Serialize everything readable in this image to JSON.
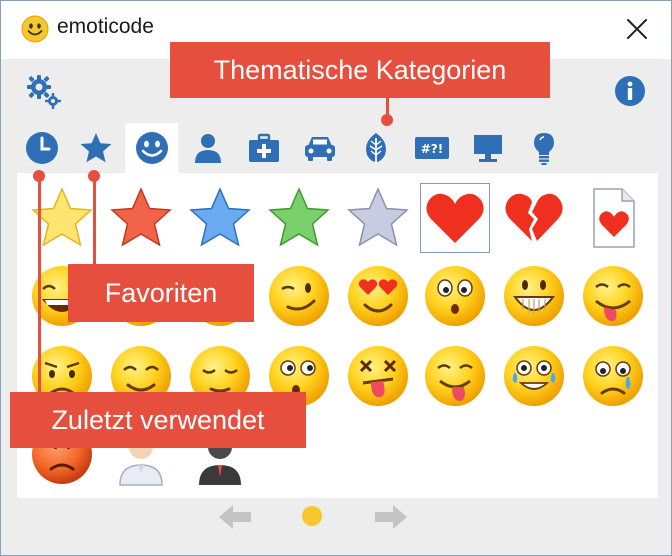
{
  "window": {
    "title": "emoticode"
  },
  "icons": {
    "app": "smiley-icon",
    "close": "close-icon",
    "settings": "gear-icon",
    "info": "info-icon",
    "prev": "arrow-left-icon",
    "next": "arrow-right-icon"
  },
  "tabs": [
    {
      "icon": "clock-icon",
      "active": false
    },
    {
      "icon": "star-icon",
      "active": false
    },
    {
      "icon": "smiley-icon",
      "active": true
    },
    {
      "icon": "person-icon",
      "active": false
    },
    {
      "icon": "medical-kit-icon",
      "active": false
    },
    {
      "icon": "car-icon",
      "active": false
    },
    {
      "icon": "leaf-icon",
      "active": false
    },
    {
      "icon": "symbols-icon",
      "active": false,
      "label": "#?!"
    },
    {
      "icon": "monitor-icon",
      "active": false
    },
    {
      "icon": "lightbulb-icon",
      "active": false
    }
  ],
  "grid": {
    "rows": [
      [
        "star-yellow-icon",
        "star-red-icon",
        "star-blue-icon",
        "star-green-icon",
        "star-silver-icon",
        "heart-icon",
        "broken-heart-icon",
        "heart-document-icon"
      ],
      [
        "laughing-face-icon",
        "smiling-face-icon",
        "grinning-face-icon",
        "winking-face-icon",
        "heart-eyes-face-icon",
        "surprised-face-icon",
        "toothy-grin-face-icon",
        "tongue-wink-face-icon"
      ],
      [
        "worried-face-icon",
        "content-face-icon",
        "relieved-face-icon",
        "confused-face-icon",
        "dizzy-face-icon",
        "tongue-out-face-icon",
        "tears-of-joy-face-icon",
        "crying-face-icon"
      ],
      [
        "angry-face-icon",
        "scientist-icon",
        "dark-person-icon"
      ]
    ],
    "selected": "heart-icon"
  },
  "pager": {
    "current_page": 1,
    "page_count": 1,
    "dot_color": "#f7c72c"
  },
  "callouts": {
    "categories": "Thematische Kategorien",
    "favorites": "Favoriten",
    "recent": "Zuletzt verwendet"
  },
  "colors": {
    "callout": "#e64f3e",
    "emoji_yellow": "#f7c72c",
    "accent_blue": "#2f6fb6"
  }
}
